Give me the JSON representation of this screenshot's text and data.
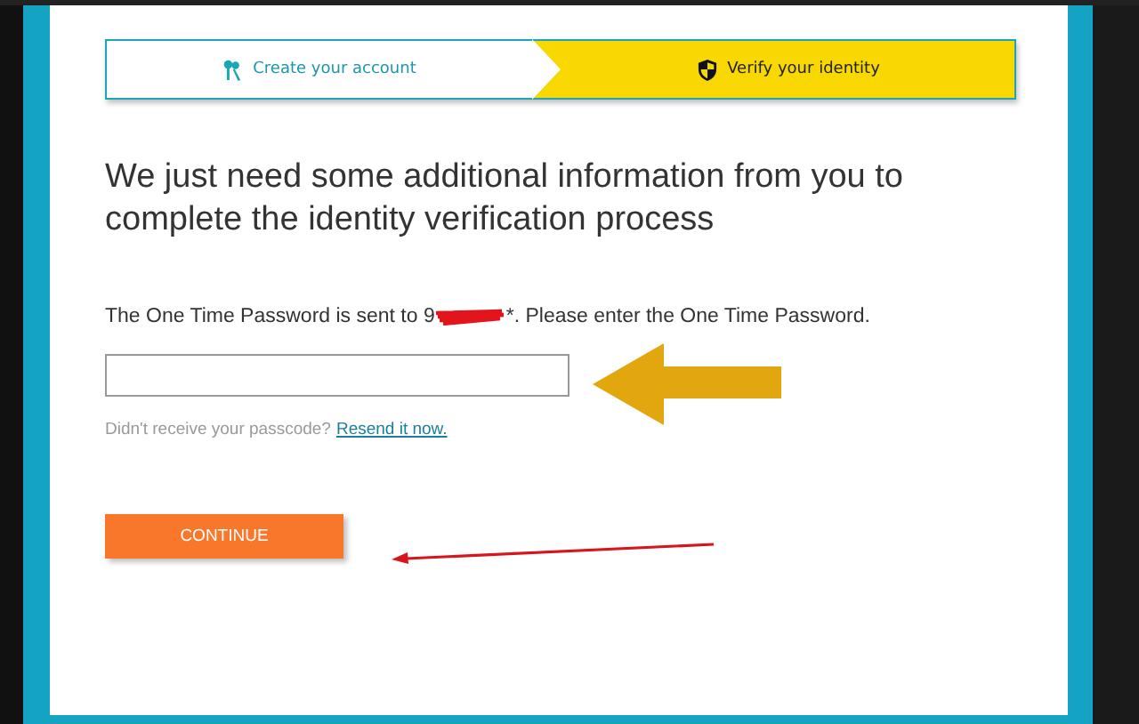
{
  "steps": [
    {
      "label": "Create your account",
      "selected": false
    },
    {
      "label": "Verify your identity",
      "selected": true
    }
  ],
  "heading": "We just need some additional information from you to complete the identity verification process",
  "otp_message": {
    "before": "The One Time Password is sent to 9",
    "after": "*. Please enter the One Time Password."
  },
  "resend": {
    "question": "Didn't receive your passcode?",
    "link": "Resend it now."
  },
  "continue_button": "CONTINUE"
}
